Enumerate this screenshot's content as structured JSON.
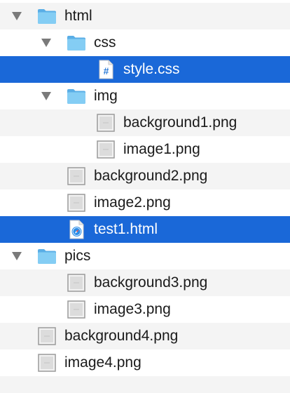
{
  "tree": {
    "rows": [
      {
        "label": "html",
        "icon": "folder-icon",
        "expanded": true,
        "depth": 0
      },
      {
        "label": "css",
        "icon": "folder-icon",
        "expanded": true,
        "depth": 1
      },
      {
        "label": "style.css",
        "icon": "css-file-icon",
        "depth": 2,
        "selected": true
      },
      {
        "label": "img",
        "icon": "folder-icon",
        "expanded": true,
        "depth": 1
      },
      {
        "label": "background1.png",
        "icon": "image-file-icon",
        "depth": 2
      },
      {
        "label": "image1.png",
        "icon": "image-file-icon",
        "depth": 2
      },
      {
        "label": "background2.png",
        "icon": "image-file-icon",
        "depth": 1
      },
      {
        "label": "image2.png",
        "icon": "image-file-icon",
        "depth": 1
      },
      {
        "label": "test1.html",
        "icon": "html-file-icon",
        "depth": 1,
        "selected": true
      },
      {
        "label": "pics",
        "icon": "folder-icon",
        "expanded": true,
        "depth": 0
      },
      {
        "label": "background3.png",
        "icon": "image-file-icon",
        "depth": 1
      },
      {
        "label": "image3.png",
        "icon": "image-file-icon",
        "depth": 1
      },
      {
        "label": "background4.png",
        "icon": "image-file-icon",
        "depth": 0
      },
      {
        "label": "image4.png",
        "icon": "image-file-icon",
        "depth": 0
      }
    ]
  },
  "colors": {
    "selection": "#1a68d8",
    "stripe": "#f4f4f4",
    "folder": "#7cc7f2",
    "text": "#1a1a1a",
    "selected_text": "#ffffff"
  }
}
